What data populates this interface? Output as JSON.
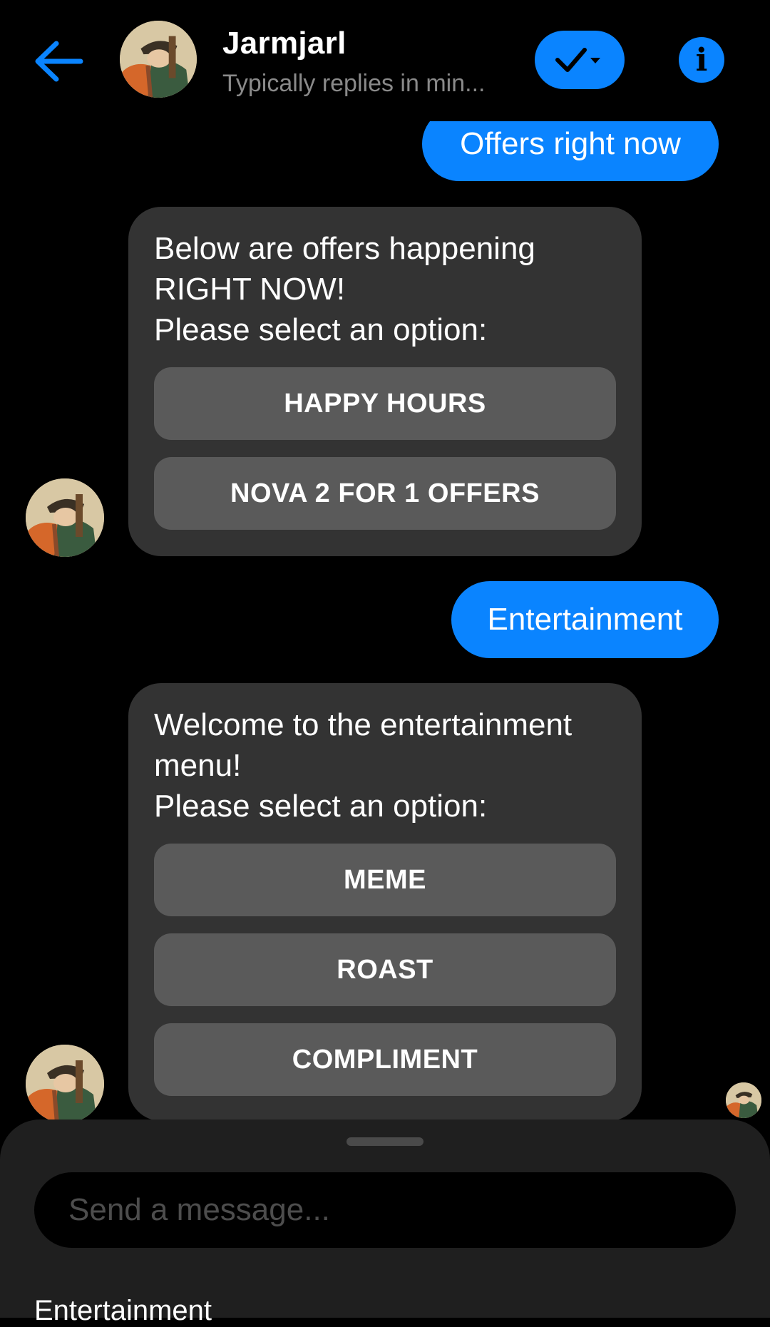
{
  "header": {
    "back_icon": "arrow-left-icon",
    "contact_name": "Jarmjarl",
    "contact_status": "Typically replies in min...",
    "status_icon": "check-dropdown-icon",
    "info_icon": "info-icon",
    "info_glyph": "i",
    "accent_color": "#0a84ff"
  },
  "messages": {
    "outgoing_1": "Offers right now",
    "incoming_1": {
      "text": "Below are offers happening\nRIGHT NOW!\nPlease select an option:",
      "options": [
        "HAPPY HOURS",
        "NOVA 2 FOR 1 OFFERS"
      ]
    },
    "outgoing_2": "Entertainment",
    "incoming_2": {
      "text": "Welcome to the entertainment\nmenu!\nPlease select an option:",
      "options": [
        "MEME",
        "ROAST",
        "COMPLIMENT"
      ]
    }
  },
  "composer": {
    "placeholder": "Send a message...",
    "value": ""
  },
  "quick_reply": {
    "label": "Entertainment"
  }
}
